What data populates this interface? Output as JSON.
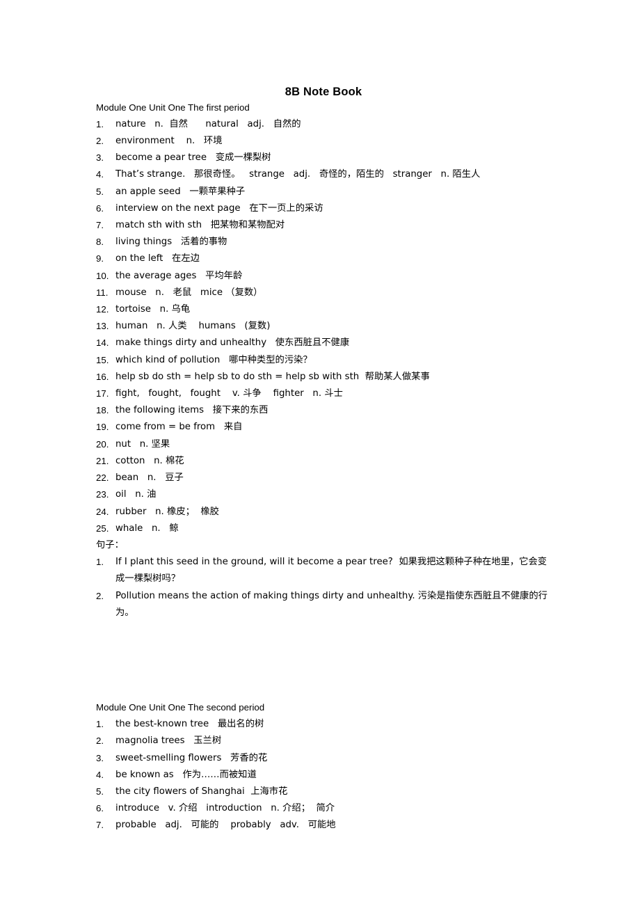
{
  "document": {
    "title": "8B Note Book"
  },
  "sections": [
    {
      "heading": "Module One Unit One The first period",
      "items": [
        {
          "num": "1.",
          "text": "nature   n.  自然      natural   adj.   自然的"
        },
        {
          "num": "2.",
          "text": "environment    n.   环境"
        },
        {
          "num": "3.",
          "text": "become a pear tree   变成一棵梨树"
        },
        {
          "num": "4.",
          "text": "That’s strange.   那很奇怪。   strange   adj.   奇怪的，陌生的   stranger   n. 陌生人"
        },
        {
          "num": "5.",
          "text": "an apple seed   一颗苹果种子"
        },
        {
          "num": "6.",
          "text": "interview on the next page   在下一页上的采访"
        },
        {
          "num": "7.",
          "text": "match sth with sth   把某物和某物配对"
        },
        {
          "num": "8.",
          "text": "living things   活着的事物"
        },
        {
          "num": "9.",
          "text": "on the left   在左边"
        },
        {
          "num": "10.",
          "text": "the average ages   平均年龄"
        },
        {
          "num": "11.",
          "text": "mouse   n.   老鼠   mice （复数）"
        },
        {
          "num": "12.",
          "text": "tortoise   n. 乌龟"
        },
        {
          "num": "13.",
          "text": "human   n. 人类    humans   (复数)"
        },
        {
          "num": "14.",
          "text": "make things dirty and unhealthy   使东西脏且不健康"
        },
        {
          "num": "15.",
          "text": "which kind of pollution   哪中种类型的污染？"
        },
        {
          "num": "16.",
          "text": "help sb do sth = help sb to do sth = help sb with sth  帮助某人做某事"
        },
        {
          "num": "17.",
          "text": "fight,   fought,   fought    v. 斗争    fighter   n. 斗士"
        },
        {
          "num": "18.",
          "text": "the following items   接下来的东西"
        },
        {
          "num": "19.",
          "text": "come from = be from   来自"
        },
        {
          "num": "20.",
          "text": "nut   n. 坚果"
        },
        {
          "num": "21.",
          "text": "cotton   n. 棉花"
        },
        {
          "num": "22.",
          "text": "bean   n.   豆子"
        },
        {
          "num": "23.",
          "text": "oil   n. 油"
        },
        {
          "num": "24.",
          "text": "rubber   n. 橡皮；  橡胶"
        },
        {
          "num": "25.",
          "text": "whale   n.   鲸"
        }
      ],
      "sentences_label": "句子：",
      "sentences": [
        {
          "num": "1.",
          "text": "If I plant this seed in the ground, will it become a pear tree?  如果我把这颗种子种在地里，它会变成一棵梨树吗？"
        },
        {
          "num": "2.",
          "text": "Pollution means the action of making things dirty and unhealthy. 污染是指使东西脏且不健康的行为。"
        }
      ]
    },
    {
      "heading": "Module One Unit One The second period",
      "items": [
        {
          "num": "1.",
          "text": "the best-known tree   最出名的树"
        },
        {
          "num": "2.",
          "text": "magnolia trees   玉兰树"
        },
        {
          "num": "3.",
          "text": "sweet-smelling flowers   芳香的花"
        },
        {
          "num": "4.",
          "text": "be known as   作为……而被知道"
        },
        {
          "num": "5.",
          "text": "the city flowers of Shanghai  上海市花"
        },
        {
          "num": "6.",
          "text": "introduce   v. 介绍   introduction   n. 介绍；  简介"
        },
        {
          "num": "7.",
          "text": "probable   adj.   可能的    probably   adv.   可能地"
        }
      ]
    }
  ]
}
